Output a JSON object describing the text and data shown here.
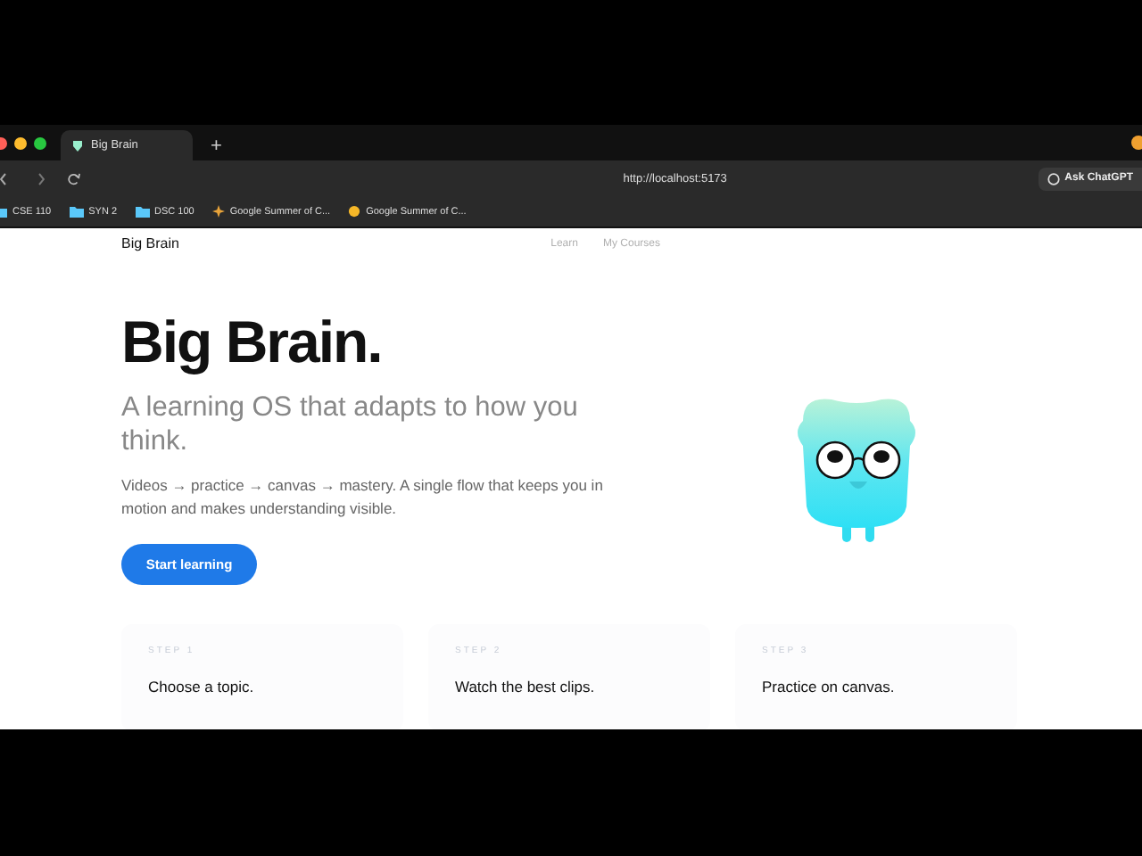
{
  "browser": {
    "tabs": [
      {
        "title": "Big Brain",
        "selected": true
      }
    ],
    "new_tab": "+",
    "url": "http://localhost:5173",
    "assistant_button": "Ask ChatGPT",
    "bookmarks": [
      {
        "label": "CSE 110",
        "kind": "folder"
      },
      {
        "label": "SYN 2",
        "kind": "folder"
      },
      {
        "label": "DSC 100",
        "kind": "folder"
      },
      {
        "label": "Google Summer of C...",
        "kind": "star"
      },
      {
        "label": "Google Summer of C...",
        "kind": "sun"
      }
    ]
  },
  "nav": {
    "brand": "Big Brain",
    "links": [
      "Learn",
      "My Courses"
    ]
  },
  "hero": {
    "title": "Big Brain.",
    "subtitle": "A learning OS that adapts to how you think.",
    "description": "Videos → practice → canvas → mastery. A single flow that keeps you in motion and makes understanding visible.",
    "cta": "Start learning"
  },
  "steps": [
    {
      "label": "STEP 1",
      "title": "Choose a topic."
    },
    {
      "label": "STEP 2",
      "title": "Watch the best clips."
    },
    {
      "label": "STEP 3",
      "title": "Practice on canvas."
    }
  ]
}
